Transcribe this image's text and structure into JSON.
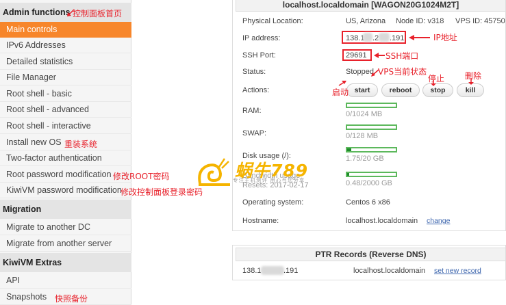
{
  "sidebar": {
    "sections": [
      {
        "title": "Admin functions",
        "items": [
          "Main controls",
          "IPv6 Addresses",
          "Detailed statistics",
          "File Manager",
          "Root shell - basic",
          "Root shell - advanced",
          "Root shell - interactive",
          "Install new OS",
          "Two-factor authentication",
          "Root password modification",
          "KiwiVM password modification"
        ]
      },
      {
        "title": "Migration",
        "items": [
          "Migrate to another DC",
          "Migrate from another server"
        ]
      },
      {
        "title": "KiwiVM Extras",
        "items": [
          "API",
          "Snapshots"
        ]
      }
    ]
  },
  "annotations": {
    "admin": "控制面板首页",
    "install_os": "重装系统",
    "root_pw": "修改ROOT密码",
    "kiwi_pw": "修改控制面板登录密码",
    "snapshots": "快照备份",
    "ip": "IP地址",
    "ssh": "SSH端口",
    "status": "VPS当前状态",
    "start": "启动",
    "stop": "停止",
    "kill": "删除"
  },
  "server": {
    "title": "localhost.localdomain   [WAGON20G1024M2T]",
    "location_label": "Physical Location:",
    "location": "US, Arizona",
    "node_id": "Node ID: v318",
    "vps_id": "VPS ID: 45750",
    "ip_label": "IP address:",
    "ip_start": "138.1",
    "ip_mid": ".2",
    "ip_end": ".191",
    "ssh_label": "SSH Port:",
    "ssh_port": "29691",
    "status_label": "Status:",
    "status": "Stopped",
    "actions_label": "Actions:",
    "buttons": {
      "start": "start",
      "reboot": "reboot",
      "stop": "stop",
      "kill": "kill"
    },
    "ram_label": "RAM:",
    "ram": "0/1024 MB",
    "ram_fraction": 0.0,
    "swap_label": "SWAP:",
    "swap": "0/128 MB",
    "swap_fraction": 0.0,
    "disk_label": "Disk usage (/):",
    "disk": "1.75/20 GB",
    "disk_fraction": 0.0875,
    "bw_label": "Bandwidth usage",
    "bw_resets": "Resets: 2017-02-17",
    "bw": "0.48/2000 GB",
    "bw_fraction": 0.0002,
    "os_label": "Operating system:",
    "os": "Centos 6 x86",
    "hostname_label": "Hostname:",
    "hostname": "localhost.localdomain",
    "change_link": "change"
  },
  "ptr": {
    "title": "PTR Records (Reverse DNS)",
    "ip_start": "138.1",
    "ip_end": ".191",
    "hostname": "localhost.localdomain",
    "set_link": "set new record"
  },
  "watermark": {
    "brand": "蜗牛789",
    "tagline": "专注主机测评  用心与您分享"
  },
  "colors": {
    "accent": "#f7862b",
    "annotation": "#e8212b",
    "bar": "#5cb85c",
    "link": "#3b64ad"
  }
}
